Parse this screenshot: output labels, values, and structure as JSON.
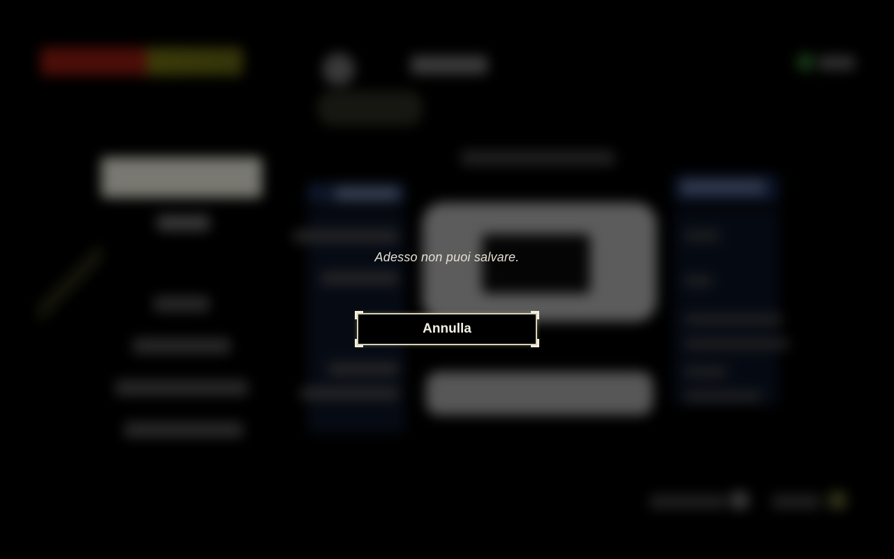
{
  "dialog": {
    "message": "Adesso non puoi salvare.",
    "cancel_label": "Annulla"
  },
  "colors": {
    "background": "#000000",
    "dialog_text": "#e4e0d2",
    "button_border": "#d8d2b8",
    "health_red": "#8a1a10",
    "health_yellow": "#5d5f12"
  }
}
